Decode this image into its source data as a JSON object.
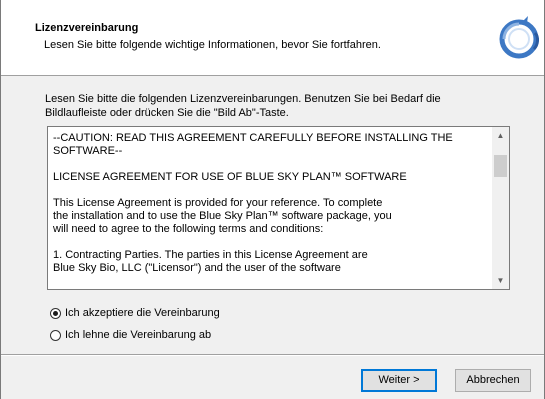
{
  "header": {
    "title": "Lizenzvereinbarung",
    "subtitle": "Lesen Sie bitte folgende wichtige Informationen, bevor Sie fortfahren.",
    "logo_icon": "blue-sky-logo-icon"
  },
  "intro": {
    "line1": "Lesen Sie bitte die folgenden Lizenzvereinbarungen. Benutzen Sie bei Bedarf die",
    "line2": "Bildlaufleiste oder drücken Sie die \"Bild Ab\"-Taste."
  },
  "license": {
    "paragraphs": [
      "--CAUTION:  READ THIS AGREEMENT CAREFULLY BEFORE INSTALLING THE\nSOFTWARE--",
      "LICENSE AGREEMENT FOR USE OF BLUE SKY PLAN™ SOFTWARE",
      "This License Agreement is provided for your reference. To complete\nthe installation and to use the Blue Sky Plan™ software package, you\nwill need to agree to the following terms and conditions:",
      "1. Contracting Parties. The parties in this License Agreement are\nBlue Sky Bio, LLC (\"Licensor\") and the user of the software"
    ]
  },
  "options": {
    "accept": "Ich akzeptiere die Vereinbarung",
    "decline": "Ich lehne die Vereinbarung ab",
    "selected": "accept"
  },
  "buttons": {
    "next": "Weiter >",
    "cancel": "Abbrechen"
  },
  "colors": {
    "logo_blue": "#3d78c4",
    "default_button_border": "#0078d7"
  }
}
